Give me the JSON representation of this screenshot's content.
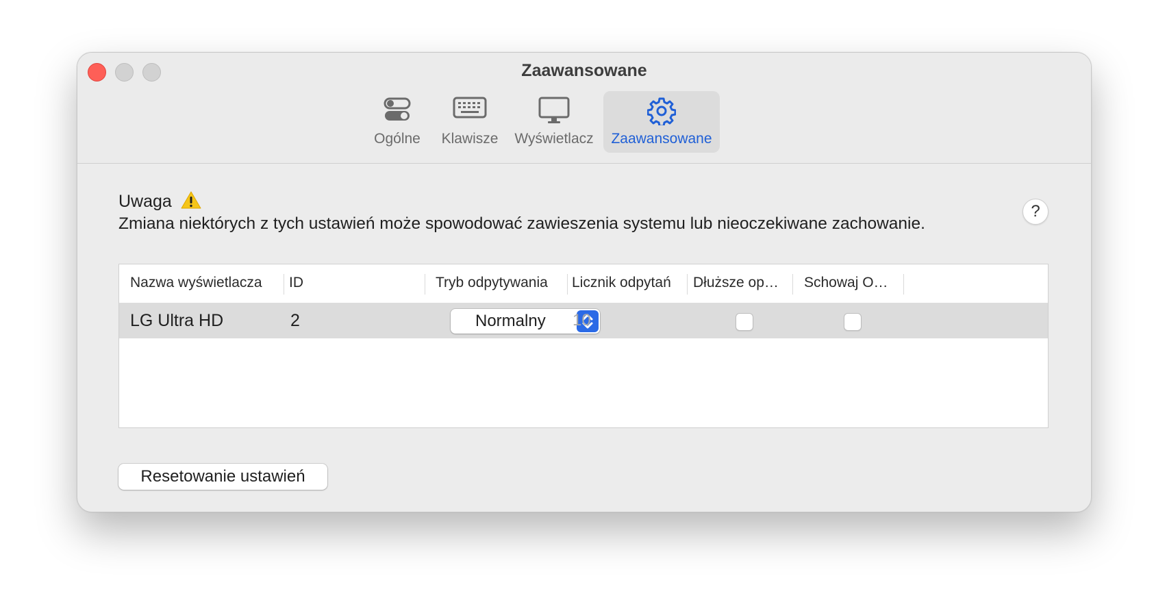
{
  "window": {
    "title": "Zaawansowane"
  },
  "tabs": [
    {
      "label": "Ogólne",
      "icon": "toggles-icon"
    },
    {
      "label": "Klawisze",
      "icon": "keyboard-icon"
    },
    {
      "label": "Wyświetlacz",
      "icon": "display-icon"
    },
    {
      "label": "Zaawansowane",
      "icon": "gear-icon",
      "active": true
    }
  ],
  "warning": {
    "title": "Uwaga",
    "text": "Zmiana niektórych z tych ustawień może spowodować zawieszenia systemu lub nieoczekiwane zachowanie.",
    "help": "?"
  },
  "table": {
    "columns": [
      "Nazwa wyświetlacza",
      "ID",
      "Tryb odpytywania",
      "Licznik odpytań",
      "Dłuższe op…",
      "Schowaj O…"
    ],
    "rows": [
      {
        "name": "LG Ultra HD",
        "id": "2",
        "mode": "Normalny",
        "count": "10",
        "longer": false,
        "hide": false
      }
    ]
  },
  "buttons": {
    "reset": "Resetowanie ustawień"
  },
  "colors": {
    "accent": "#1f5fd6",
    "close": "#fe5f57",
    "warning": "#f5c518"
  }
}
